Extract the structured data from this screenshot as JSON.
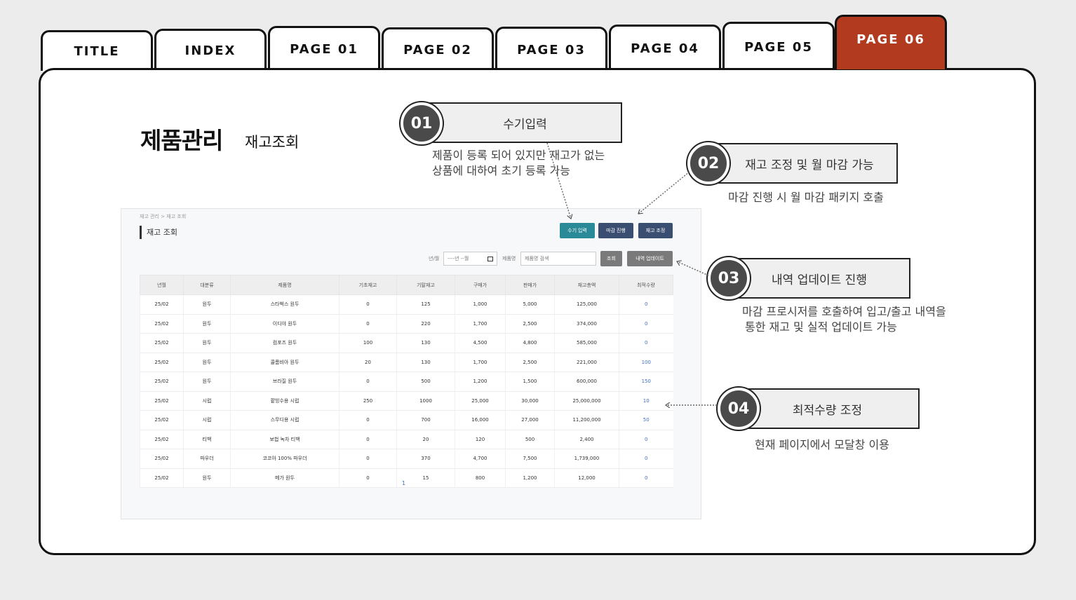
{
  "tabs": [
    {
      "label": "TITLE"
    },
    {
      "label": "INDEX"
    },
    {
      "label": "PAGE 01"
    },
    {
      "label": "PAGE 02"
    },
    {
      "label": "PAGE 03"
    },
    {
      "label": "PAGE 04"
    },
    {
      "label": "PAGE 05"
    },
    {
      "label": "PAGE 06",
      "active": true
    }
  ],
  "heading": {
    "main": "제품관리",
    "sub": "재고조회"
  },
  "callouts": [
    {
      "num": "01",
      "title": "수기입력",
      "desc_line1": "제품이 등록 되어 있지만 재고가 없는",
      "desc_line2": "상품에 대하여 초기 등록 가능"
    },
    {
      "num": "02",
      "title": "재고 조정 및 월 마감 가능",
      "desc_line1": "마감 진행 시 월 마감 패키지 호출"
    },
    {
      "num": "03",
      "title": "내역 업데이트 진행",
      "desc_line1": "마감 프로시저를 호출하여 입고/출고 내역을",
      "desc_line2": "통한 재고 및 실적 업데이트 가능"
    },
    {
      "num": "04",
      "title": "최적수량 조정",
      "desc_line1": "현재 페이지에서 모달창 이용"
    }
  ],
  "screen": {
    "breadcrumb": "재고 관리 > 재고 조회",
    "page_title": "재고 조회",
    "buttons": {
      "manual": "수기 입력",
      "close": "마감 진행",
      "adjust": "재고 조정",
      "search": "조회",
      "update": "내역 업데이트"
    },
    "filters": {
      "month_label": "년/월",
      "month_value": "----년 --월",
      "product_label": "제품명",
      "product_placeholder": "제품명 검색"
    },
    "columns": [
      "년월",
      "대분류",
      "제품명",
      "기초재고",
      "기말재고",
      "구매가",
      "판매가",
      "재고총액",
      "최적수량"
    ],
    "rows": [
      [
        "25/02",
        "원두",
        "스타벅스 원두",
        "0",
        "125",
        "1,000",
        "5,000",
        "125,000",
        "0"
      ],
      [
        "25/02",
        "원두",
        "이디야 원두",
        "0",
        "220",
        "1,700",
        "2,500",
        "374,000",
        "0"
      ],
      [
        "25/02",
        "원두",
        "컴포즈 원두",
        "100",
        "130",
        "4,500",
        "4,800",
        "585,000",
        "0"
      ],
      [
        "25/02",
        "원두",
        "콜롬비아 원두",
        "20",
        "130",
        "1,700",
        "2,500",
        "221,000",
        "100"
      ],
      [
        "25/02",
        "원두",
        "브라질 원두",
        "0",
        "500",
        "1,200",
        "1,500",
        "600,000",
        "150"
      ],
      [
        "25/02",
        "시럽",
        "팥빙수용 시럽",
        "250",
        "1000",
        "25,000",
        "30,000",
        "25,000,000",
        "10"
      ],
      [
        "25/02",
        "시럽",
        "스무디용 시럽",
        "0",
        "700",
        "16,000",
        "27,000",
        "11,200,000",
        "50"
      ],
      [
        "25/02",
        "티백",
        "보헙 녹차 티백",
        "0",
        "20",
        "120",
        "500",
        "2,400",
        "0"
      ],
      [
        "25/02",
        "파우더",
        "코코아 100% 파우더",
        "0",
        "370",
        "4,700",
        "7,500",
        "1,739,000",
        "0"
      ],
      [
        "25/02",
        "원두",
        "메가 원두",
        "0",
        "15",
        "800",
        "1,200",
        "12,000",
        "0"
      ]
    ],
    "pagination": "1"
  },
  "colors": {
    "active_tab": "#b23a1f",
    "btn_teal": "#2a8a98",
    "btn_navy": "#3a4e72",
    "btn_gray": "#7a7a7a",
    "qty_blue": "#3d6fc6"
  }
}
